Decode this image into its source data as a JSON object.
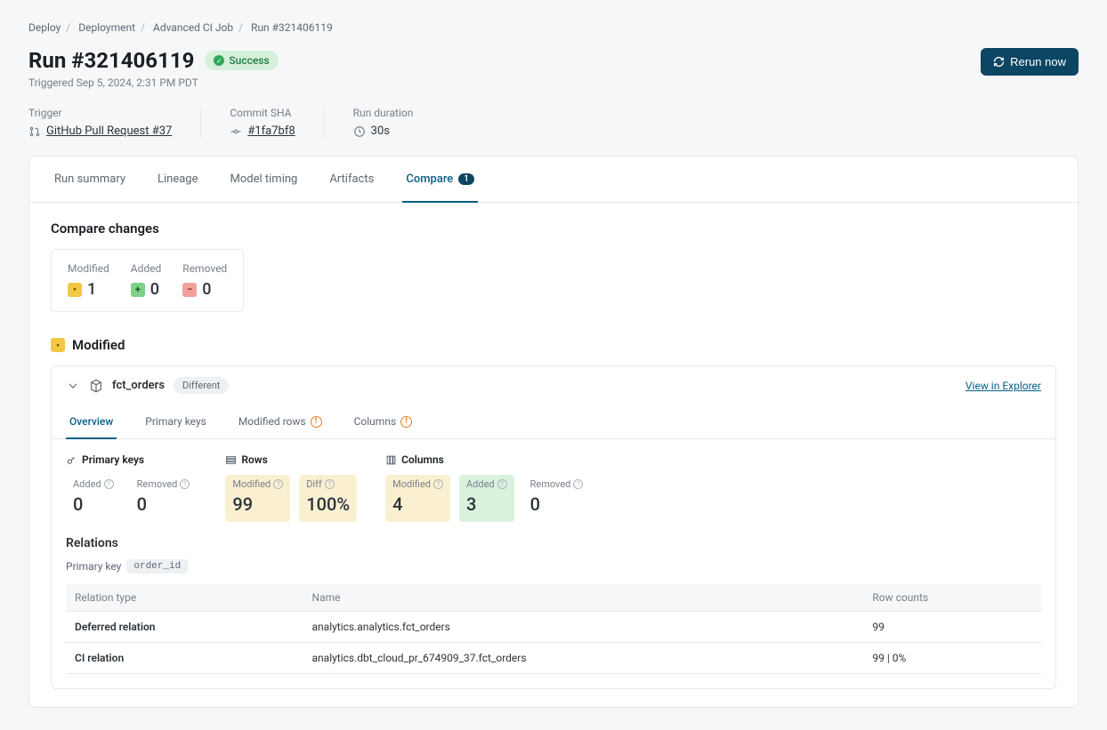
{
  "breadcrumb": [
    "Deploy",
    "Deployment",
    "Advanced CI Job",
    "Run #321406119"
  ],
  "title": "Run #321406119",
  "status": "Success",
  "triggered": "Triggered Sep 5, 2024, 2:31 PM PDT",
  "rerun_label": "Rerun now",
  "meta": {
    "trigger": {
      "label": "Trigger",
      "value": "GitHub Pull Request #37"
    },
    "commit": {
      "label": "Commit SHA",
      "value": "#1fa7bf8"
    },
    "duration": {
      "label": "Run duration",
      "value": "30s"
    }
  },
  "tabs": [
    "Run summary",
    "Lineage",
    "Model timing",
    "Artifacts",
    "Compare"
  ],
  "compare_badge": "1",
  "compare_title": "Compare changes",
  "summary": {
    "modified": {
      "label": "Modified",
      "value": "1"
    },
    "added": {
      "label": "Added",
      "value": "0"
    },
    "removed": {
      "label": "Removed",
      "value": "0"
    }
  },
  "modified_header": "Modified",
  "model": {
    "name": "fct_orders",
    "diff_label": "Different",
    "view_link": "View in Explorer",
    "inner_tabs": [
      "Overview",
      "Primary keys",
      "Modified rows",
      "Columns"
    ],
    "groups": {
      "pk": {
        "title": "Primary keys",
        "added": {
          "label": "Added",
          "value": "0"
        },
        "removed": {
          "label": "Removed",
          "value": "0"
        }
      },
      "rows": {
        "title": "Rows",
        "modified": {
          "label": "Modified",
          "value": "99"
        },
        "diff": {
          "label": "Diff",
          "value": "100%"
        }
      },
      "cols": {
        "title": "Columns",
        "modified": {
          "label": "Modified",
          "value": "4"
        },
        "added": {
          "label": "Added",
          "value": "3"
        },
        "removed": {
          "label": "Removed",
          "value": "0"
        }
      }
    },
    "relations": {
      "title": "Relations",
      "pk_label": "Primary key",
      "pk_value": "order_id",
      "headers": [
        "Relation type",
        "Name",
        "Row counts"
      ],
      "rows": [
        {
          "type": "Deferred relation",
          "name": "analytics.analytics.fct_orders",
          "count": "99"
        },
        {
          "type": "CI relation",
          "name": "analytics.dbt_cloud_pr_674909_37.fct_orders",
          "count": "99 | 0%"
        }
      ]
    }
  }
}
